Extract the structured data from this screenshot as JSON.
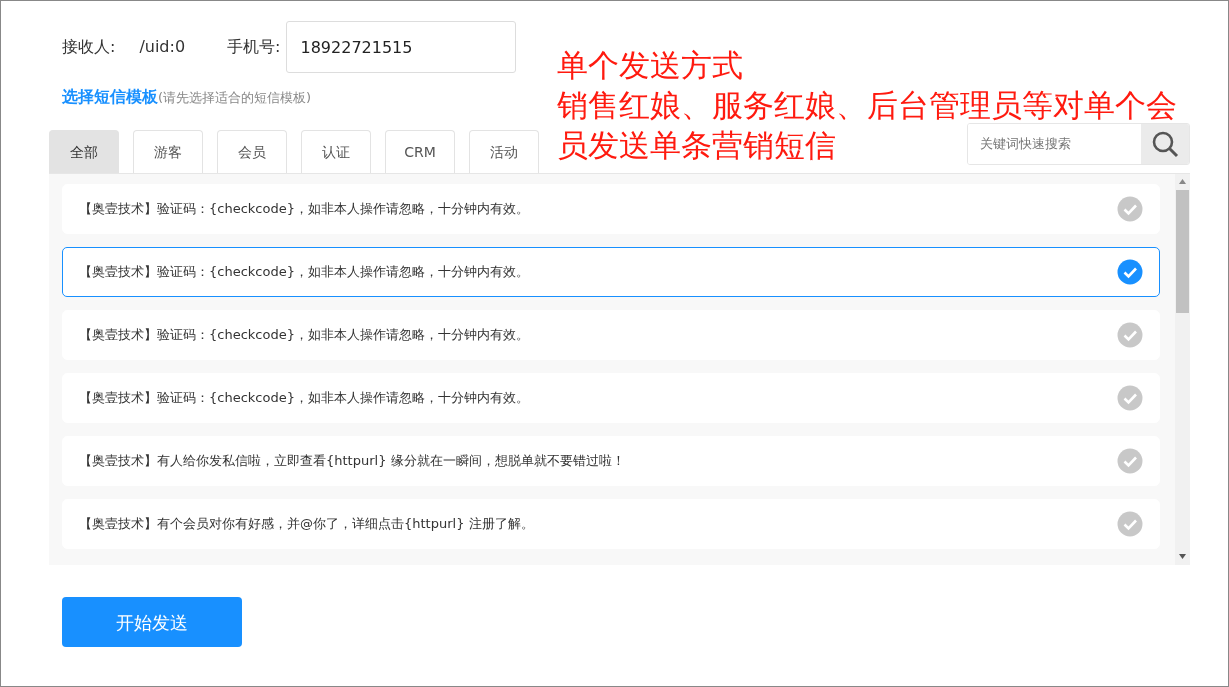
{
  "recipient": {
    "label": "接收人:",
    "value": "/uid:0"
  },
  "phone": {
    "label": "手机号:",
    "value": "18922721515"
  },
  "template_heading": {
    "title": "选择短信模板",
    "hint": "(请先选择适合的短信模板)"
  },
  "tabs": [
    {
      "label": "全部",
      "selected": true
    },
    {
      "label": "游客",
      "selected": false
    },
    {
      "label": "会员",
      "selected": false
    },
    {
      "label": "认证",
      "selected": false
    },
    {
      "label": "CRM",
      "selected": false
    },
    {
      "label": "活动",
      "selected": false
    }
  ],
  "search": {
    "placeholder": "关键词快速搜索"
  },
  "templates": [
    {
      "text": "【奥壹技术】验证码：{checkcode}，如非本人操作请忽略，十分钟内有效。",
      "selected": false
    },
    {
      "text": "【奥壹技术】验证码：{checkcode}，如非本人操作请忽略，十分钟内有效。",
      "selected": true
    },
    {
      "text": "【奥壹技术】验证码：{checkcode}，如非本人操作请忽略，十分钟内有效。",
      "selected": false
    },
    {
      "text": "【奥壹技术】验证码：{checkcode}，如非本人操作请忽略，十分钟内有效。",
      "selected": false
    },
    {
      "text": "【奥壹技术】有人给你发私信啦，立即查看{httpurl} 缘分就在一瞬间，想脱单就不要错过啦！",
      "selected": false
    },
    {
      "text": "【奥壹技术】有个会员对你有好感，并@你了，详细点击{httpurl} 注册了解。",
      "selected": false
    }
  ],
  "send_button": "开始发送",
  "annotation": {
    "title": "单个发送方式",
    "lines": [
      "销售红娘、服务红娘、后台管理员等对单个会",
      "员发送单条营销短信"
    ]
  }
}
